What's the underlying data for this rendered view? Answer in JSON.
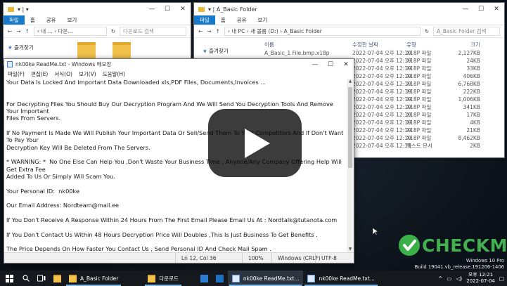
{
  "explorer_left": {
    "tabs": [
      "파일",
      "홈",
      "공유",
      "보기"
    ],
    "address": "› 내 ... › 다운...",
    "search_placeholder": "다운로드 검색",
    "quick_access": "즐겨찾기"
  },
  "explorer_right": {
    "title": "A_Basic Folder",
    "tabs": [
      "파일",
      "홈",
      "공유",
      "보기"
    ],
    "address": "› 내 PC › 새 볼륨 (D:) › A_Basic Folder",
    "search_placeholder": "A_Basic Folder 검색",
    "quick_access": "즐겨찾기",
    "columns": {
      "name": "이름",
      "modified": "수정한 날짜",
      "type": "유형",
      "size": "크기"
    },
    "files": [
      {
        "name": "A_Basic_1 File.bmp.x18p",
        "modified": "2022-07-04 오후 12:19",
        "type": "X18P 파일",
        "size": "2,127KB"
      },
      {
        "name": "",
        "modified": "2022-07-04 오후 12:19",
        "type": "X18P 파일",
        "size": "24KB"
      },
      {
        "name": "",
        "modified": "2022-07-04 오후 12:19",
        "type": "X18P 파일",
        "size": "33KB"
      },
      {
        "name": "",
        "modified": "2022-07-04 오후 12:19",
        "type": "X18P 파일",
        "size": "406KB"
      },
      {
        "name": "",
        "modified": "2022-07-04 오후 12:19",
        "type": "X18P 파일",
        "size": "6,768KB"
      },
      {
        "name": "",
        "modified": "2022-07-04 오후 12:19",
        "type": "X18P 파일",
        "size": "222KB"
      },
      {
        "name": "",
        "modified": "2022-07-04 오후 12:19",
        "type": "X18P 파일",
        "size": "1,006KB"
      },
      {
        "name": "",
        "modified": "2022-07-04 오후 12:19",
        "type": "X18P 파일",
        "size": "341KB"
      },
      {
        "name": "",
        "modified": "2022-07-04 오후 12:19",
        "type": "X18P 파일",
        "size": "17KB"
      },
      {
        "name": "",
        "modified": "2022-07-04 오후 12:19",
        "type": "X18P 파일",
        "size": "4KB"
      },
      {
        "name": "",
        "modified": "2022-07-04 오후 12:19",
        "type": "X18P 파일",
        "size": "21KB"
      },
      {
        "name": "",
        "modified": "2022-07-04 오후 12:19",
        "type": "X18P 파일",
        "size": "8,462KB"
      },
      {
        "name": "",
        "modified": "2022-07-04 오후 12:19",
        "type": "텍스트 문서",
        "size": "2KB"
      }
    ]
  },
  "notepad": {
    "title": "nk00ke ReadMe.txt - Windows 메모장",
    "menu": [
      "파일(F)",
      "편집(E)",
      "서식(O)",
      "보기(V)",
      "도움말(H)"
    ],
    "lines": [
      "Your Data Is Locked And Important Data Downloaded xls,PDF Files, Documents,Invoices ...",
      "",
      "For Decrypting Files You Should Buy Our Decryption Program And We Will Send You Decryption Tools And Remove Your Important\nFiles From Servers.",
      "If No Payment Is Made We Will Publish Your Important Data Or Sell/Send Them To Your Competitors And If Don't Want To Pay Your\nDecryption Key Will Be Deleted From The Servers.",
      "* WARNING: *  No One Else Can Help You ,Don't Waste Your Business Time , Anyone/Any Company Offering Help Will Get Extra Fee\nAdded To Us Or Simply Will Scam You.",
      "Your Personal ID:  nk00ke",
      "Our Email Address: Nordteam@mail.ee",
      "If You Don't Receive A Response Within 24 Hours From The First Email Please Email Us At : Nordtalk@tutanota.com",
      "If You Don't Contact Us Within 48 Hours Decryption Price Will Doubles ,This Is Just Business To Get Benefits .",
      "The Price Depends On How Faster You Contact Us , Send Personal ID And Check Mail Spam ."
    ],
    "status": {
      "position": "Ln 12, Col 36",
      "zoom": "100%",
      "eol": "Windows (CRLF)",
      "encoding": "UTF-8"
    }
  },
  "watermark": "CHECKMAL",
  "windows_version": {
    "line1": "Windows 10 Pro",
    "line2": "Build 19041.vb_release.191206-1406"
  },
  "taskbar": {
    "apps": [
      {
        "label": "A_Basic Folder",
        "icon": "folder-icon",
        "active": false
      },
      {
        "label": "다운로드",
        "icon": "folder-icon",
        "active": false
      },
      {
        "label": "nk00ke ReadMe.txt...",
        "icon": "notepad-icon",
        "active": true
      },
      {
        "label": "nk00ke ReadMe.txt...",
        "icon": "notepad-icon",
        "active": false
      }
    ],
    "time": "오후 12:21",
    "date": "2022-07-04"
  },
  "colors": {
    "accent": "#1979ca",
    "watermark": "#42b04e",
    "taskbar": "#15191e"
  }
}
